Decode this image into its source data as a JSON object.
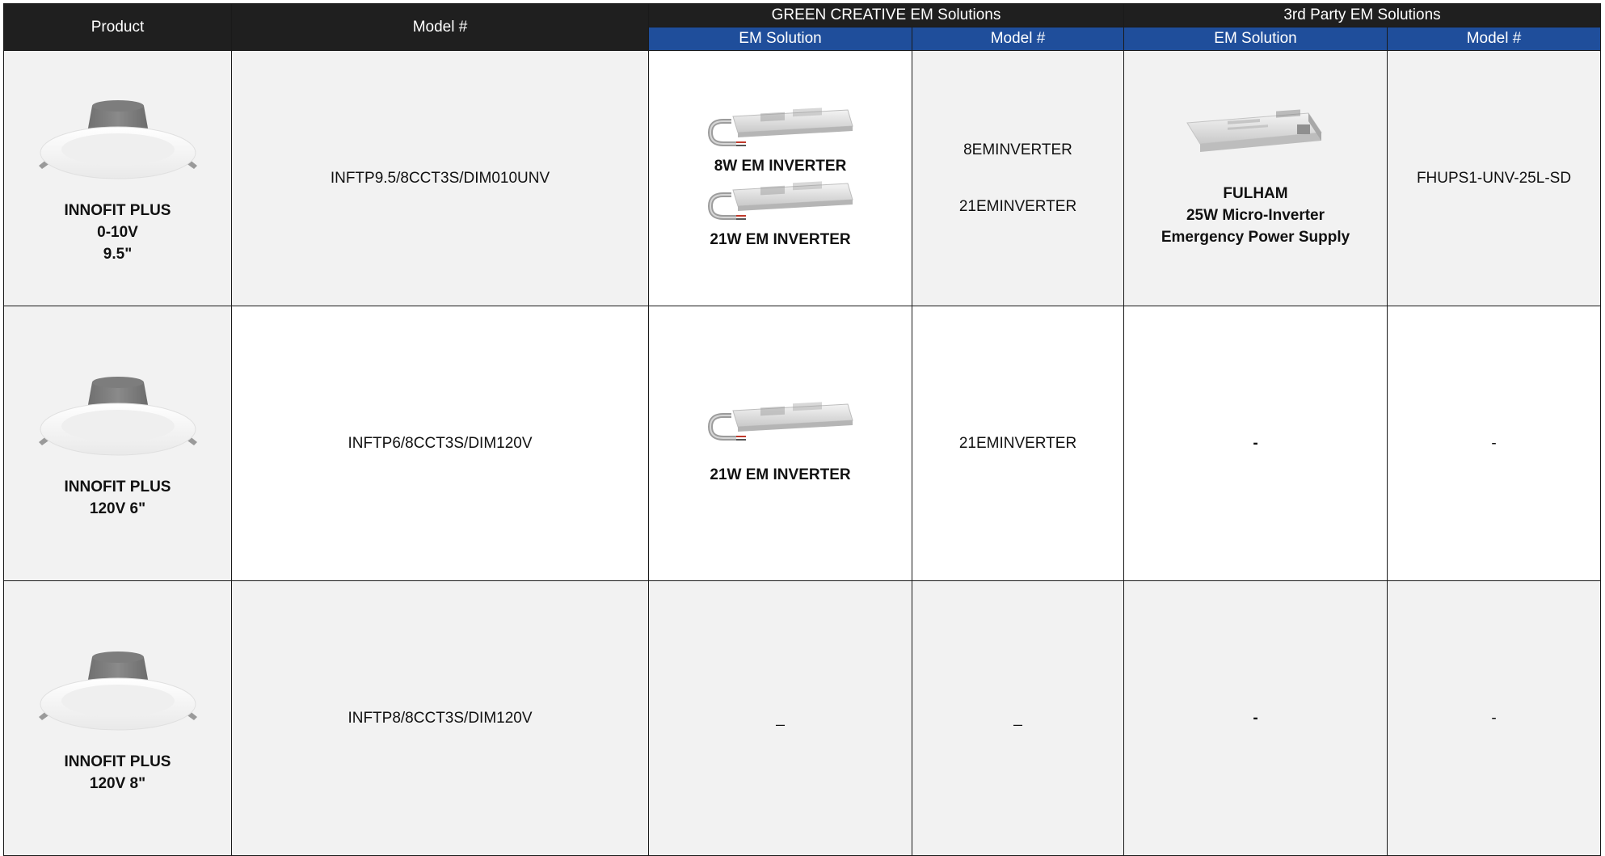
{
  "headers": {
    "product": "Product",
    "model": "Model #",
    "green_group": "GREEN CREATIVE EM Solutions",
    "third_group": "3rd Party EM Solutions",
    "gc_solution": "EM Solution",
    "gc_model": "Model #",
    "tp_solution": "EM Solution",
    "tp_model": "Model #"
  },
  "rows": [
    {
      "product_name": "INNOFIT PLUS",
      "product_line2": "0-10V",
      "product_line3": "9.5\"",
      "model": "INFTP9.5/8CCT3S/DIM010UNV",
      "gc_solutions": [
        "8W EM INVERTER",
        "21W EM INVERTER"
      ],
      "gc_models": [
        "8EMINVERTER",
        "21EMINVERTER"
      ],
      "tp_solution_brand": "FULHAM",
      "tp_solution_line2": "25W Micro-Inverter",
      "tp_solution_line3": "Emergency Power Supply",
      "tp_model": "FHUPS1-UNV-25L-SD"
    },
    {
      "product_name": "INNOFIT PLUS",
      "product_line2": "120V 6\"",
      "model": "INFTP6/8CCT3S/DIM120V",
      "gc_solutions": [
        "21W EM INVERTER"
      ],
      "gc_models": [
        "21EMINVERTER"
      ],
      "tp_solution": "-",
      "tp_model": "-"
    },
    {
      "product_name": "INNOFIT PLUS",
      "product_line2": "120V 8\"",
      "model": "INFTP8/8CCT3S/DIM120V",
      "gc_solution": "_",
      "gc_model": "_",
      "tp_solution": "-",
      "tp_model": "-"
    }
  ],
  "icons": {
    "product": "downlight-icon",
    "inverter": "em-inverter-icon",
    "power_supply": "fulham-power-supply-icon"
  },
  "colors": {
    "header_dark": "#1f1f1f",
    "header_blue": "#1f4e9b",
    "row_grey": "#f2f2f2"
  }
}
